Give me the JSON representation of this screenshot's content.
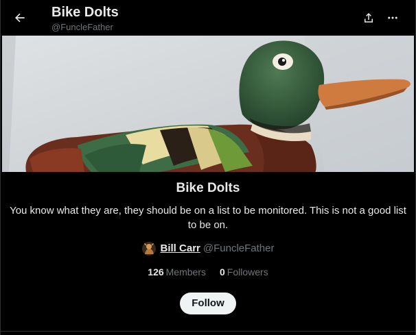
{
  "header": {
    "title": "Bike Dolts",
    "handle": "@FuncleFather"
  },
  "list": {
    "name": "Bike Dolts",
    "description": "You know what they are, they should be on a list to be monitored. This is not a good list to be on.",
    "owner": {
      "name": "Bill Carr",
      "handle": "@FuncleFather"
    },
    "stats": {
      "members_count": "126",
      "members_label": "Members",
      "followers_count": "0",
      "followers_label": "Followers"
    },
    "follow_label": "Follow"
  },
  "icons": {
    "back": "arrow-left-icon",
    "share": "share-icon",
    "more": "more-horizontal-icon"
  },
  "colors": {
    "background": "#000000",
    "text_primary": "#e7e9ea",
    "text_secondary": "#71767b",
    "button_bg": "#eff3f4",
    "button_text": "#0f1419"
  }
}
